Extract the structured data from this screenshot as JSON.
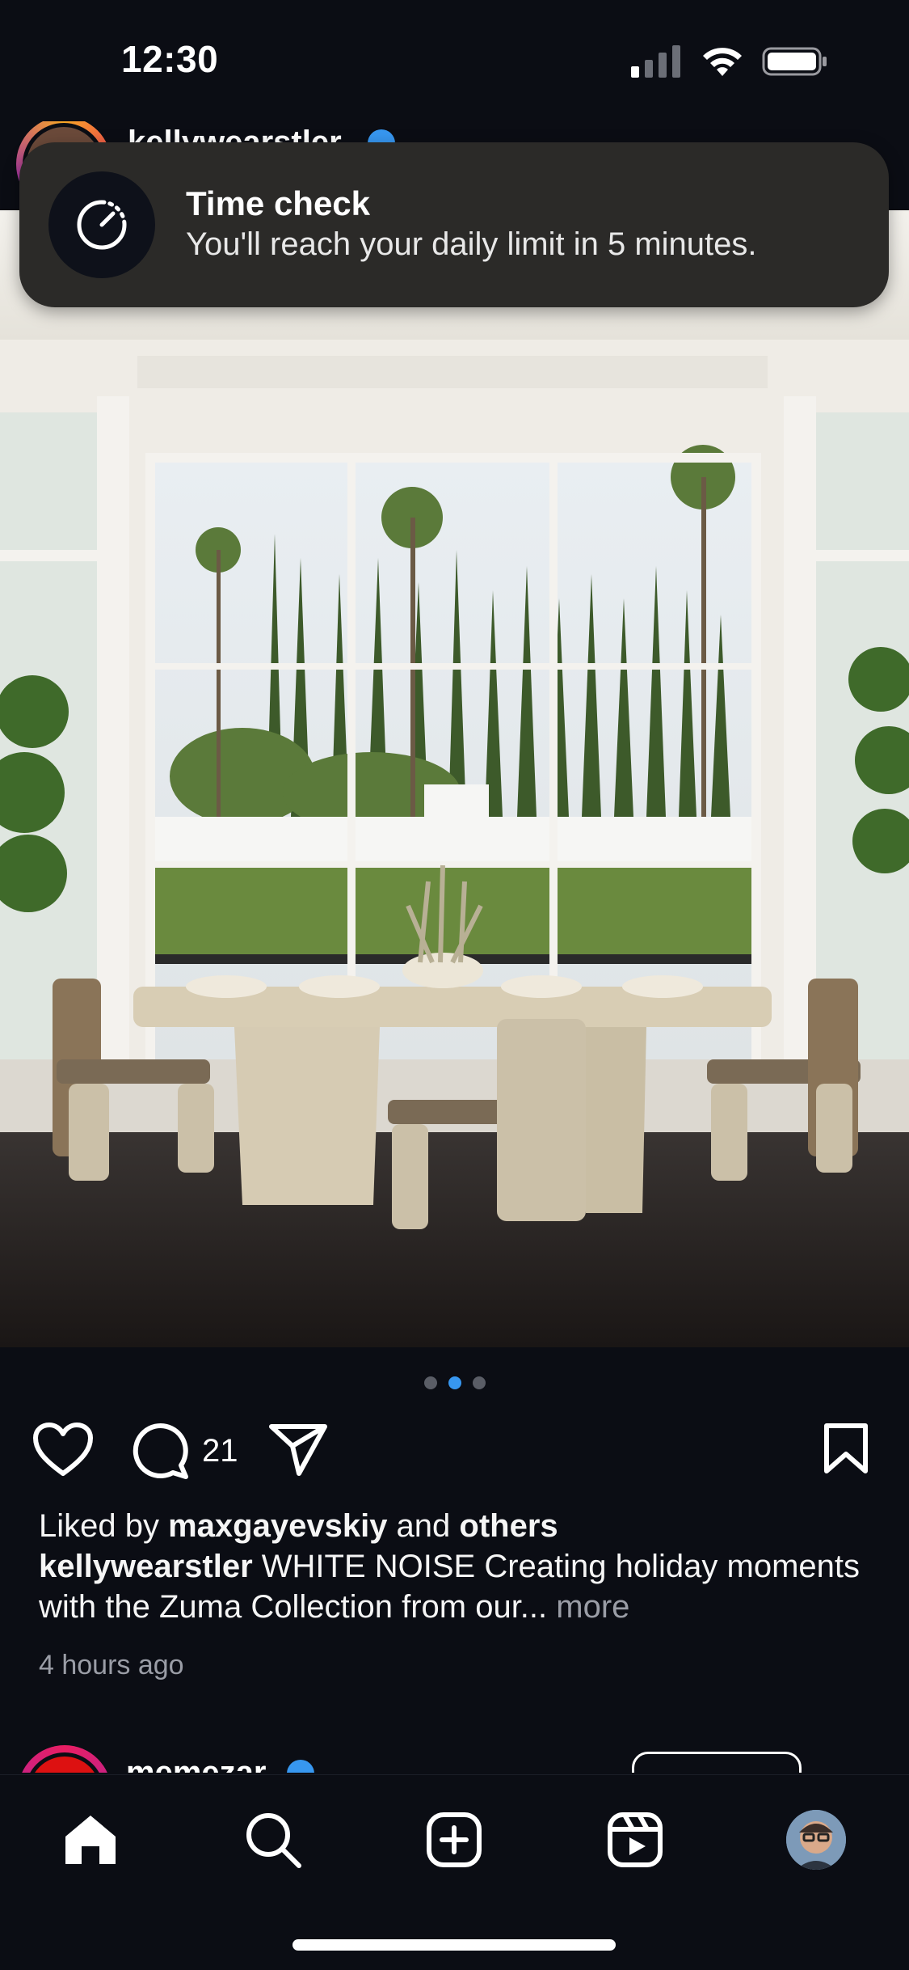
{
  "status_bar": {
    "time": "12:30",
    "icons": [
      "cellular-signal-icon",
      "wifi-icon",
      "battery-icon"
    ]
  },
  "post": {
    "username": "kellywearstler",
    "verified": true,
    "photo_alt_icon": "dining-room-photo",
    "carousel": {
      "count": 3,
      "active_index": 1
    },
    "comment_count": "21",
    "liked_by_prefix": "Liked by ",
    "liked_by_user": "maxgayevskiy",
    "liked_by_and": " and ",
    "liked_by_others": "others",
    "caption_user": "kellywearstler",
    "caption_text": " WHITE NOISE Creating holiday moments with the Zuma Collection from our... ",
    "more_label": "more",
    "timestamp": "4 hours ago"
  },
  "toast": {
    "title": "Time check",
    "body": "You'll reach your daily limit in 5 minutes.",
    "icon": "timer-icon"
  },
  "next_post": {
    "username": "memezar",
    "verified": true
  },
  "nav": {
    "items": [
      "home-icon",
      "search-icon",
      "create-icon",
      "reels-icon",
      "profile-avatar"
    ],
    "active": "home"
  },
  "colors": {
    "background": "#0b0d14",
    "accent": "#3797f0",
    "toast_bg": "#2b2a28",
    "secondary_text": "#9a9da6"
  }
}
